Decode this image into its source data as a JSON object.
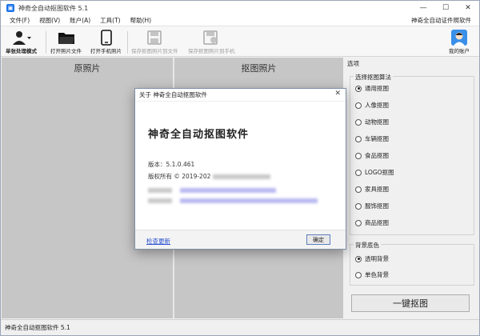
{
  "window": {
    "title": "神奇全自动抠图软件 5.1"
  },
  "menu": {
    "items": [
      "文件(F)",
      "视图(V)",
      "账户(A)",
      "工具(T)",
      "帮助(H)"
    ],
    "right_label": "神奇全自动证件照软件"
  },
  "toolbar": {
    "single_mode": "单张处理模式",
    "open_file": "打开照片文件",
    "open_phone": "打开手机照片",
    "save_file": "保存抠图照片到文件",
    "save_phone": "保存抠图照片到手机",
    "account": "我的账户"
  },
  "panels": {
    "original": "原照片",
    "cutout": "抠图照片"
  },
  "options": {
    "title": "选项",
    "algo_title": "选择抠图算法",
    "algorithms": [
      "通用抠图",
      "人像抠图",
      "动物抠图",
      "车辆抠图",
      "食品抠图",
      "LOGO抠图",
      "家具抠图",
      "服饰抠图",
      "商品抠图"
    ],
    "selected_algorithm": "通用抠图",
    "bg_title": "背景底色",
    "backgrounds": [
      "透明背景",
      "单色背景"
    ],
    "selected_background": "透明背景",
    "action": "一键抠图"
  },
  "status": {
    "text": "神奇全自动抠图软件 5.1"
  },
  "dialog": {
    "title": "关于 神奇全自动抠图软件",
    "heading": "神奇全自动抠图软件",
    "version": "版本：5.1.0.461",
    "copyright": "版权所有 © 2019-202",
    "check_update": "检查更新",
    "ok": "确定"
  },
  "colors": {
    "accent": "#1a73e8",
    "link": "#2a4fd0"
  }
}
